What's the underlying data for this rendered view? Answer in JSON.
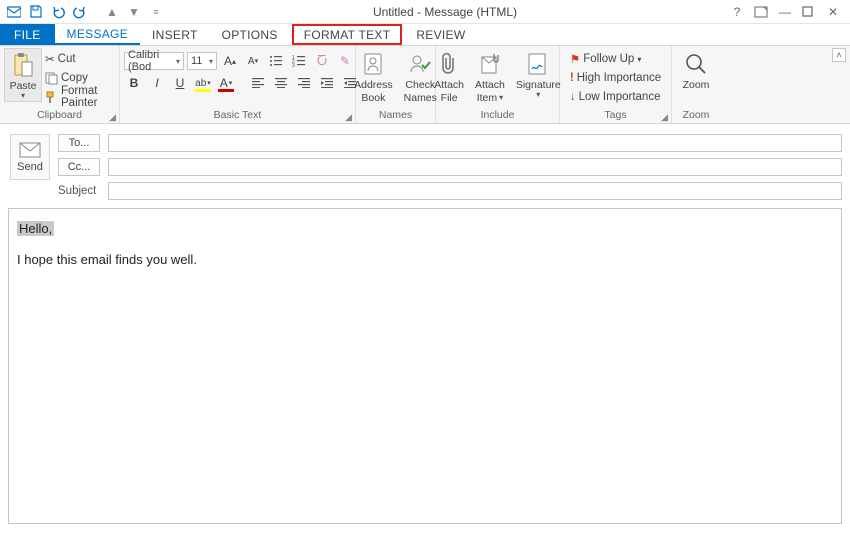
{
  "window": {
    "title": "Untitled - Message (HTML)",
    "controls": {
      "help": "?",
      "present": "▢",
      "min": "—",
      "restore": "❐",
      "close": "✕"
    }
  },
  "qat": {
    "icons": [
      "outlook",
      "save",
      "undo",
      "redo",
      "prev",
      "next",
      "customize"
    ]
  },
  "tabs": {
    "file": "FILE",
    "message": "MESSAGE",
    "insert": "INSERT",
    "options": "OPTIONS",
    "format_text": "FORMAT TEXT",
    "review": "REVIEW"
  },
  "ribbon": {
    "clipboard": {
      "label": "Clipboard",
      "paste": "Paste",
      "cut": "Cut",
      "copy": "Copy",
      "format_painter": "Format Painter"
    },
    "basic_text": {
      "label": "Basic Text",
      "font_name": "Calibri (Bod",
      "font_size": "11"
    },
    "names": {
      "label": "Names",
      "address_book_l1": "Address",
      "address_book_l2": "Book",
      "check_names_l1": "Check",
      "check_names_l2": "Names"
    },
    "include": {
      "label": "Include",
      "attach_file_l1": "Attach",
      "attach_file_l2": "File",
      "attach_item_l1": "Attach",
      "attach_item_l2": "Item",
      "signature": "Signature"
    },
    "tags": {
      "label": "Tags",
      "follow_up": "Follow Up",
      "high": "High Importance",
      "low": "Low Importance"
    },
    "zoom": {
      "label": "Zoom",
      "zoom": "Zoom"
    }
  },
  "envelope": {
    "send": "Send",
    "to": "To...",
    "cc": "Cc...",
    "subject": "Subject",
    "to_value": "",
    "cc_value": "",
    "subject_value": ""
  },
  "body": {
    "line1": "Hello,",
    "line2": "I hope this email finds you well."
  }
}
